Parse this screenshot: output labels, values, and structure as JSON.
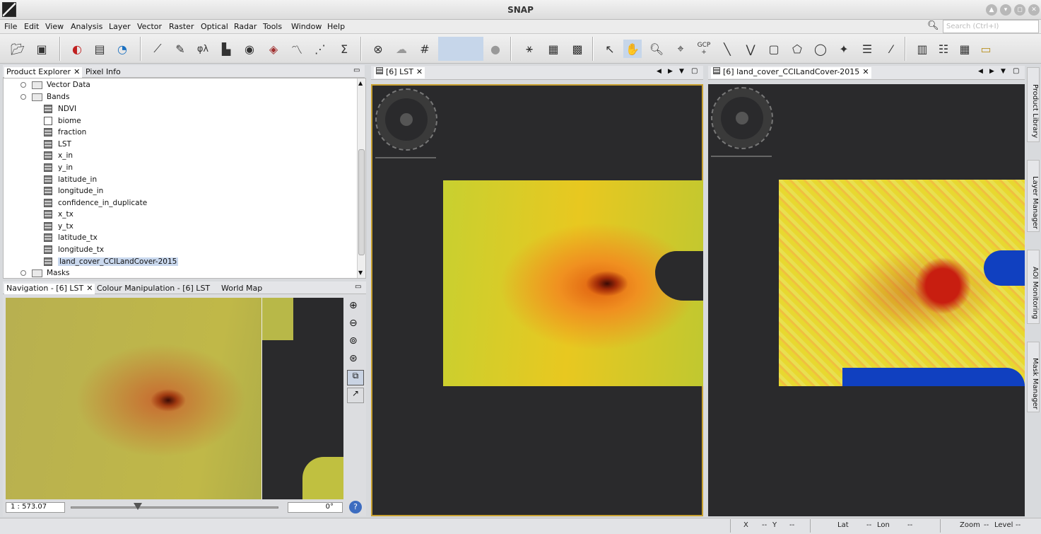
{
  "window": {
    "title": "SNAP"
  },
  "menu": [
    "File",
    "Edit",
    "View",
    "Analysis",
    "Layer",
    "Vector",
    "Raster",
    "Optical",
    "Radar",
    "Tools",
    "Window",
    "Help"
  ],
  "search": {
    "placeholder": "Search (Ctrl+I)"
  },
  "toolbar": {
    "sigma": "Σ",
    "phi": "φλ",
    "gcp": "GCP"
  },
  "product_explorer": {
    "tabs": [
      "Product Explorer",
      "Pixel Info"
    ],
    "tree": {
      "vector_data": "Vector Data",
      "bands": "Bands",
      "masks": "Masks",
      "band_items": [
        "NDVI",
        "biome",
        "fraction",
        "LST",
        "x_in",
        "y_in",
        "latitude_in",
        "longitude_in",
        "confidence_in_duplicate",
        "x_tx",
        "y_tx",
        "latitude_tx",
        "longitude_tx",
        "land_cover_CCILandCover-2015"
      ],
      "selected": "land_cover_CCILandCover-2015"
    }
  },
  "navigation": {
    "tabs": [
      "Navigation - [6] LST",
      "Colour Manipulation - [6] LST",
      "World Map"
    ],
    "scale": "1 : 573.07",
    "rotation": "0°",
    "slider_fraction": 0.32
  },
  "views": [
    {
      "tab": "[6] LST"
    },
    {
      "tab": "[6] land_cover_CCILandCover-2015"
    }
  ],
  "side_tabs": [
    "Product Library",
    "Layer Manager",
    "AOI Monitoring",
    "Mask Manager"
  ],
  "status": {
    "x": "X",
    "x_val": "--",
    "y": "Y",
    "y_val": "--",
    "lat": "Lat",
    "lat_val": "--",
    "lon": "Lon",
    "lon_val": "--",
    "zoom": "Zoom",
    "zoom_val": "--",
    "level": "Level",
    "level_val": "--"
  },
  "colors": {
    "lst_hot": "#3a0a05",
    "lst_mid": "#e8b010",
    "lst_cool": "#b8c830",
    "landcover_urban": "#c81e10",
    "landcover_water": "#1040c0",
    "background": "#2a2a2c"
  }
}
